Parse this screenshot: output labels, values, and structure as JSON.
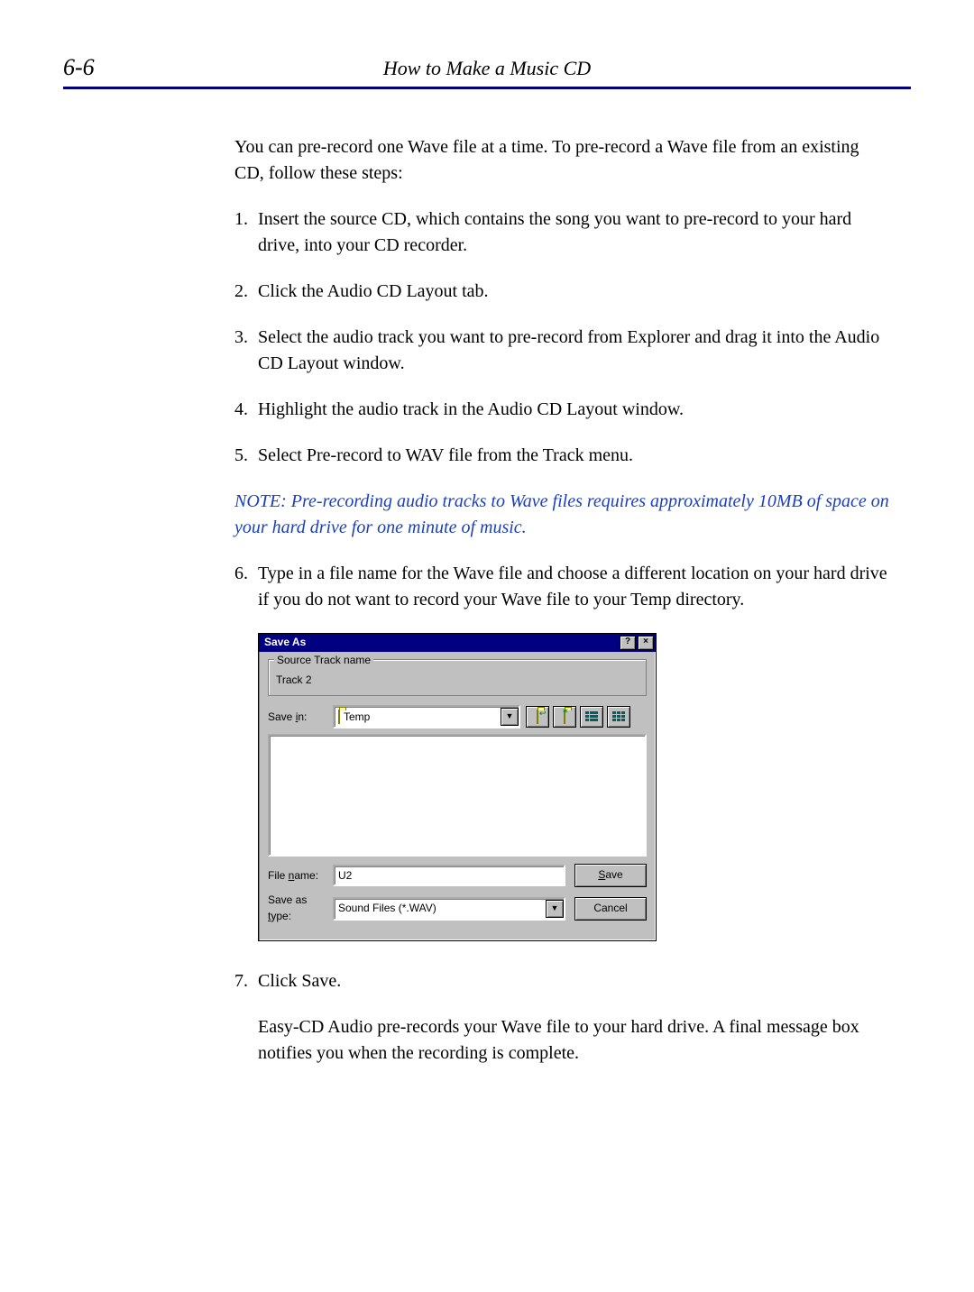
{
  "header": {
    "page_number": "6-6",
    "title": "How to Make a Music CD"
  },
  "intro": "You can pre-record one Wave file at a time. To pre-record a Wave file from an existing CD, follow these steps:",
  "steps": {
    "s1_num": "1.",
    "s1": "Insert the source CD, which contains the song you want to pre-record to your hard drive, into your CD recorder.",
    "s2_num": "2.",
    "s2": "Click the Audio CD Layout tab.",
    "s3_num": "3.",
    "s3": "Select the audio track you want to pre-record from Explorer and drag it into the Audio CD Layout window.",
    "s4_num": "4.",
    "s4": "Highlight the audio track in the Audio CD Layout window.",
    "s5_num": "5.",
    "s5": "Select Pre-record to WAV file from the Track menu.",
    "s6_num": "6.",
    "s6": "Type in a file name for the Wave file and choose a different location on your hard drive if you do not want to record your Wave file to your Temp directory.",
    "s7_num": "7.",
    "s7": "Click Save."
  },
  "note": "NOTE: Pre-recording audio tracks to Wave files requires approximately 10MB of space on your hard drive for one minute of music.",
  "post": "Easy-CD Audio pre-records your Wave file to your hard drive. A final message box notifies you when the recording is complete.",
  "dialog": {
    "title": "Save As",
    "help_glyph": "?",
    "close_glyph": "×",
    "group_legend": "Source Track name",
    "track_name": "Track 2",
    "save_in_label_pre": "Save ",
    "save_in_label_u": "i",
    "save_in_label_post": "n:",
    "save_in_value": "Temp",
    "dd_glyph": "▼",
    "file_name_label_pre": "File ",
    "file_name_label_u": "n",
    "file_name_label_post": "ame:",
    "file_name_value": "U2",
    "save_as_type_label_pre": "Save as ",
    "save_as_type_label_u": "t",
    "save_as_type_label_post": "ype:",
    "save_as_type_value": "Sound Files (*.WAV)",
    "save_btn_u": "S",
    "save_btn_rest": "ave",
    "cancel_btn": "Cancel"
  }
}
